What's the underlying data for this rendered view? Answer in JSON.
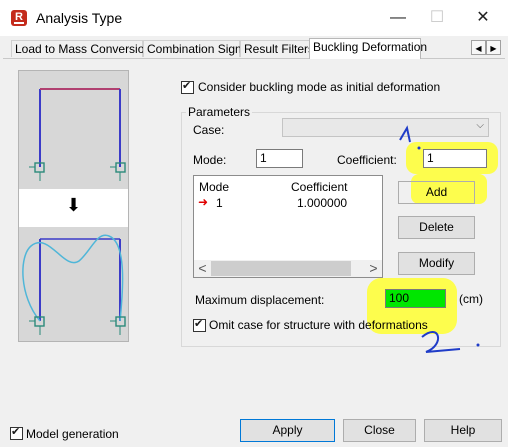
{
  "window": {
    "title": "Analysis Type",
    "app_icon_letter": "R",
    "minimize_glyph": "—",
    "maximize_glyph": "☐",
    "close_glyph": "✕"
  },
  "tabs": [
    {
      "label": "Load to Mass Conversion",
      "active": false
    },
    {
      "label": "Combination Sign",
      "active": false
    },
    {
      "label": "Result Filters",
      "active": false
    },
    {
      "label": "Buckling Deformation",
      "active": true
    }
  ],
  "tab_scroll": {
    "left": "◀",
    "right": "▶"
  },
  "preview": {
    "arrow": "⬇"
  },
  "buckling": {
    "consider_label": "Consider buckling mode as initial deformation",
    "consider_checked": true,
    "parameters_title": "Parameters",
    "case_label": "Case:",
    "case_value": "",
    "mode_label": "Mode:",
    "mode_value": "1",
    "coefficient_label": "Coefficient:",
    "coefficient_value": "1",
    "list": {
      "columns": [
        "Mode",
        "Coefficient"
      ],
      "rows": [
        {
          "mode": "1",
          "coefficient": "1.000000",
          "marker": "➜"
        }
      ],
      "scroll_left": "<",
      "scroll_right": ">"
    },
    "add_label": "Add",
    "delete_label": "Delete",
    "modify_label": "Modify",
    "max_disp_label": "Maximum displacement:",
    "max_disp_value": "100",
    "max_disp_unit": "(cm)",
    "omit_label": "Omit case for structure with deformations",
    "omit_checked": true
  },
  "footer": {
    "model_generation_label": "Model generation",
    "model_generation_checked": true,
    "apply_label": "Apply",
    "close_label": "Close",
    "help_label": "Help"
  },
  "colors": {
    "accent_red": "#c42b1c",
    "highlight_yellow": "#ffff30",
    "field_green": "#00e600",
    "annotation_blue": "#1f3cc8",
    "frame_blue": "#3b3bc8",
    "deform_cyan": "#4fb6d8"
  }
}
